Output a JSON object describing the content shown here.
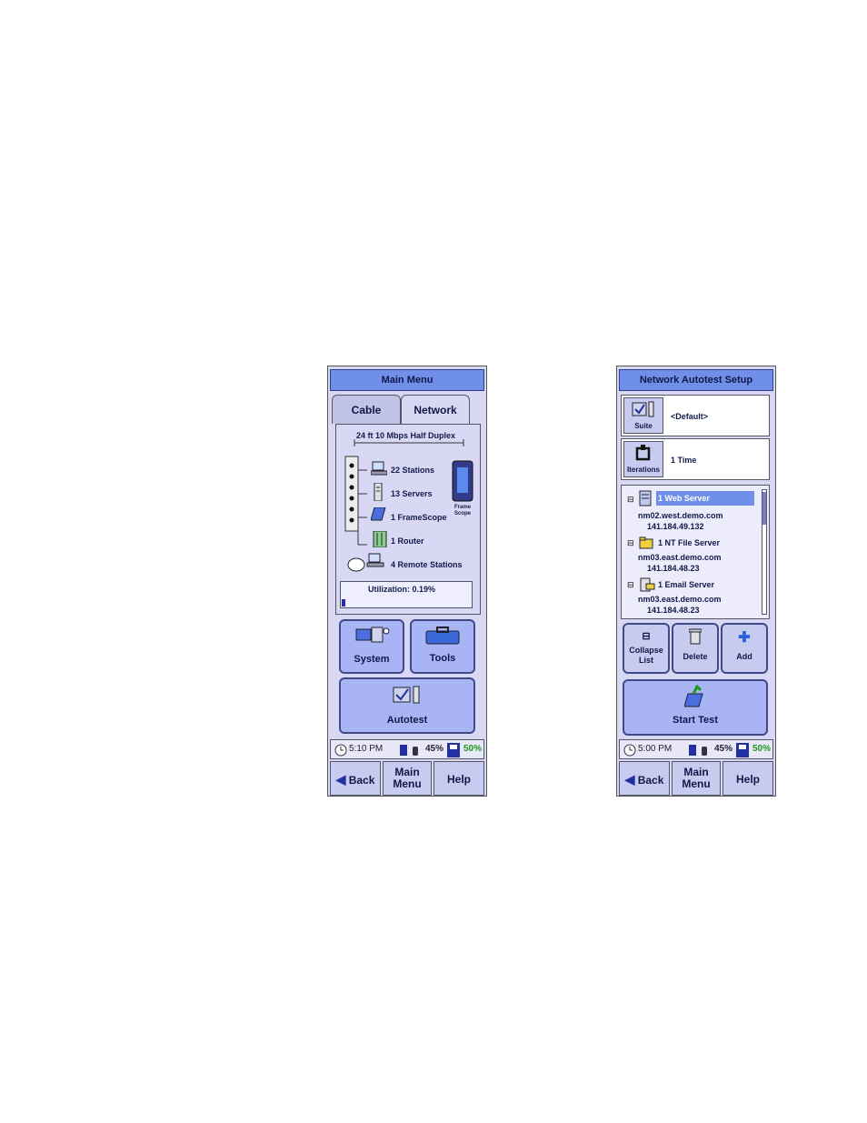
{
  "left_screen": {
    "title": "Main Menu",
    "tabs": [
      "Cable",
      "Network"
    ],
    "link": "24 ft  10 Mbps Half Duplex",
    "items": [
      "22 Stations",
      "13 Servers",
      "1 FrameScope",
      "1 Router",
      "4 Remote Stations"
    ],
    "device_label": "Frame Scope",
    "utilization": "Utilization: 0.19%",
    "buttons": {
      "system": "System",
      "tools": "Tools",
      "autotest": "Autotest"
    },
    "status": {
      "time": "5:10 PM",
      "battery": "45%",
      "disk": "50%"
    },
    "nav": {
      "back": "Back",
      "main_menu": "Main Menu",
      "help": "Help"
    }
  },
  "right_screen": {
    "title": "Network Autotest Setup",
    "suite": {
      "label": "Suite",
      "value": "<Default>"
    },
    "iterations": {
      "label": "Iterations",
      "value": "1 Time"
    },
    "tree": [
      {
        "label": "1 Web Server",
        "host": "nm02.west.demo.com",
        "ip": "141.184.49.132",
        "selected": true
      },
      {
        "label": "1 NT File Server",
        "host": "nm03.east.demo.com",
        "ip": "141.184.48.23",
        "selected": false
      },
      {
        "label": "1 Email Server",
        "host": "nm03.east.demo.com",
        "ip": "141.184.48.23",
        "selected": false
      }
    ],
    "buttons": {
      "collapse": "Collapse List",
      "delete": "Delete",
      "add": "Add",
      "start": "Start Test"
    },
    "status": {
      "time": "5:00 PM",
      "battery": "45%",
      "disk": "50%"
    },
    "nav": {
      "back": "Back",
      "main_menu": "Main Menu",
      "help": "Help"
    }
  },
  "colors": {
    "title_bar": "#6f8fe9",
    "screen_bg": "#d8d8f4",
    "button": "#a8b4f4",
    "selected": "#6f8fe9",
    "disk_text": "#1a9a1a"
  }
}
